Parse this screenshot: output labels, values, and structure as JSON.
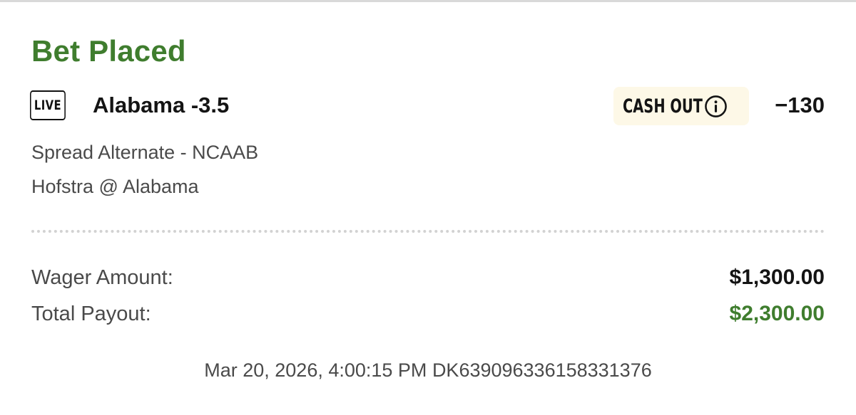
{
  "bet": {
    "status": "Bet Placed",
    "live_badge": "LIVE",
    "selection": "Alabama -3.5",
    "cash_out_label": "CASH OUT",
    "odds": "−130",
    "market": "Spread Alternate - NCAAB",
    "event": "Hofstra @ Alabama"
  },
  "details": {
    "wager_label": "Wager Amount:",
    "wager_value": "$1,300.00",
    "payout_label": "Total Payout:",
    "payout_value": "$2,300.00"
  },
  "footer": {
    "placed_at": "Mar 20, 2026, 4:00:15 PM",
    "bet_id": "DK639096336158331376"
  },
  "icons": {
    "cash_out_info": "info-circle-icon"
  },
  "colors": {
    "accent_green": "#3f7d2e",
    "cash_out_bg": "#fdf8e7",
    "text_dark": "#141414",
    "text_muted": "#4a4a4a",
    "divider": "#d2d2d2"
  }
}
